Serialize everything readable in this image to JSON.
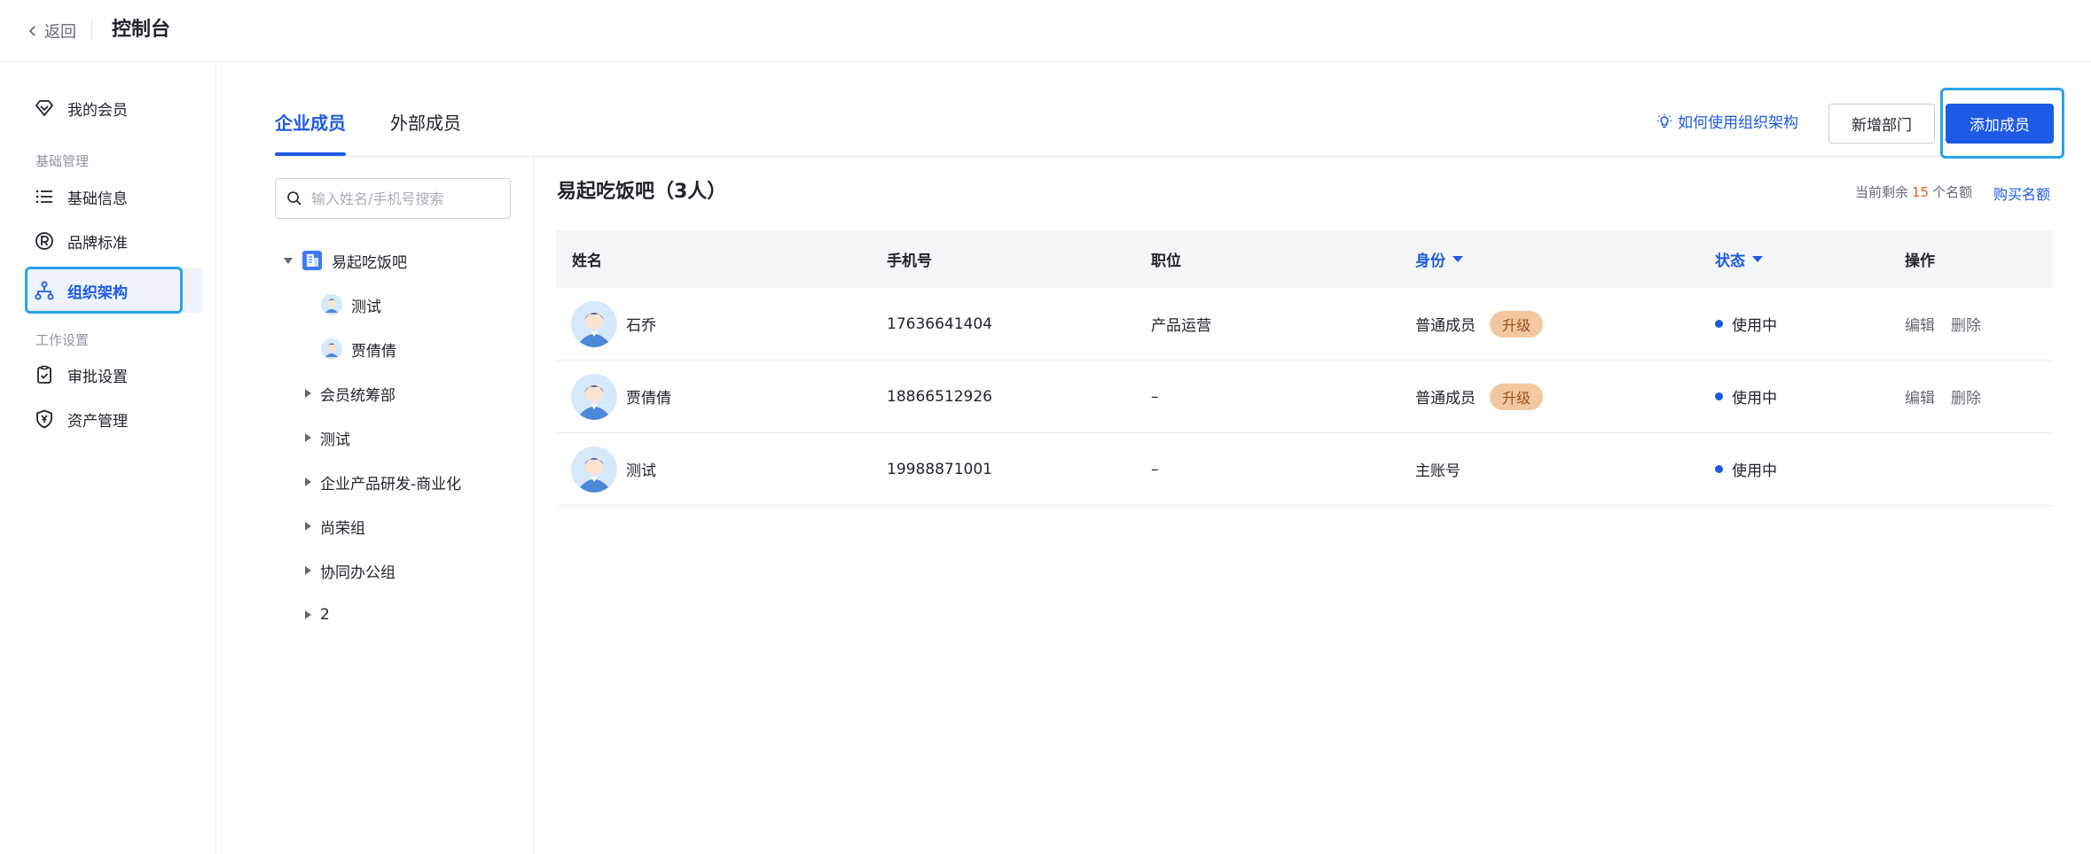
{
  "topbar": {
    "back_label": "返回",
    "title": "控制台"
  },
  "sidebar": {
    "items": [
      {
        "label": "我的会员",
        "icon": "diamond-icon"
      },
      {
        "group": "基础管理"
      },
      {
        "label": "基础信息",
        "icon": "list-icon"
      },
      {
        "label": "品牌标准",
        "icon": "registered-icon"
      },
      {
        "label": "组织架构",
        "icon": "org-tree-icon",
        "active": true
      },
      {
        "group": "工作设置"
      },
      {
        "label": "审批设置",
        "icon": "clipboard-check-icon"
      },
      {
        "label": "资产管理",
        "icon": "yen-shield-icon"
      }
    ]
  },
  "tabs": [
    {
      "label": "企业成员",
      "active": true
    },
    {
      "label": "外部成员",
      "active": false
    }
  ],
  "toolbar": {
    "help_label": "如何使用组织架构",
    "new_dept_label": "新增部门",
    "add_member_label": "添加成员"
  },
  "tree": {
    "search_placeholder": "输入姓名/手机号搜索",
    "root": "易起吃饭吧",
    "members": [
      "测试",
      "贾倩倩"
    ],
    "departments": [
      "会员统筹部",
      "测试",
      "企业产品研发-商业化",
      "尚荣组",
      "协同办公组",
      "2"
    ]
  },
  "main": {
    "title": "易起吃饭吧（3人）",
    "quota_prefix": "当前剩余",
    "quota_num": "15",
    "quota_suffix": "个名额",
    "buy_label": "购买名额"
  },
  "table": {
    "headers": {
      "name": "姓名",
      "phone": "手机号",
      "position": "职位",
      "role": "身份",
      "status": "状态",
      "ops": "操作"
    },
    "rows": [
      {
        "name": "石乔",
        "phone": "17636641404",
        "position": "产品运营",
        "role": "普通成员",
        "badge": "升级",
        "status": "使用中",
        "edit": "编辑",
        "delete": "删除"
      },
      {
        "name": "贾倩倩",
        "phone": "18866512926",
        "position": "–",
        "role": "普通成员",
        "badge": "升级",
        "status": "使用中",
        "edit": "编辑",
        "delete": "删除"
      },
      {
        "name": "测试",
        "phone": "19988871001",
        "position": "–",
        "role": "主账号",
        "status": "使用中"
      }
    ]
  },
  "colors": {
    "primary": "#1d5ae6",
    "highlight_box": "#2aa4e6",
    "badge_bg": "#f3c8a0",
    "quota_num": "#f05a2b"
  }
}
